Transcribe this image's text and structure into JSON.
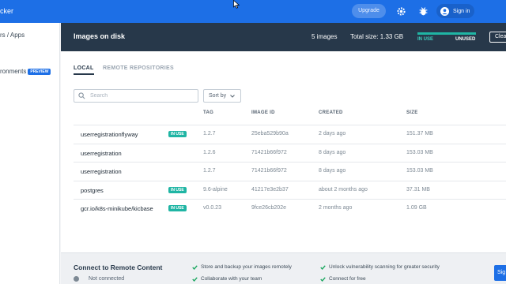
{
  "topbar": {
    "brand": "cker",
    "upgrade_label": "Upgrade",
    "signin_label": "Sign in"
  },
  "sidebar": {
    "items": [
      {
        "label": "rs / Apps"
      },
      {
        "label": "ronments",
        "badge": "PREVIEW"
      }
    ]
  },
  "header": {
    "title": "Images on disk",
    "count": "5 images",
    "total_size": "Total size: 1.33 GB",
    "usage_in_use_fraction": 1.0,
    "label_in_use": "IN USE",
    "label_unused": "UNUSED",
    "clean_label": "Clea"
  },
  "tabs": [
    {
      "label": "LOCAL",
      "active": true
    },
    {
      "label": "REMOTE REPOSITORIES",
      "active": false
    }
  ],
  "search": {
    "placeholder": "Search"
  },
  "sort": {
    "label": "Sort by"
  },
  "table": {
    "columns": [
      "TAG",
      "IMAGE ID",
      "CREATED",
      "SIZE"
    ],
    "rows": [
      {
        "name": "userregistrationflyway",
        "in_use": "IN USE",
        "tag": "1.2.7",
        "image_id": "25eba529b90a",
        "created": "2 days ago",
        "size": "151.37 MB"
      },
      {
        "name": "userregistration",
        "in_use": "",
        "tag": "1.2.6",
        "image_id": "71421b66f972",
        "created": "8 days ago",
        "size": "153.03 MB"
      },
      {
        "name": "userregistration",
        "in_use": "",
        "tag": "1.2.7",
        "image_id": "71421b66f972",
        "created": "8 days ago",
        "size": "153.03 MB"
      },
      {
        "name": "postgres",
        "in_use": "IN USE",
        "tag": "9.6-alpine",
        "image_id": "41217e3e2b37",
        "created": "about 2 months ago",
        "size": "37.31 MB"
      },
      {
        "name": "gcr.io/k8s-minikube/kicbase",
        "in_use": "IN USE",
        "tag": "v0.0.23",
        "image_id": "9fce26cb202e",
        "created": "2 months ago",
        "size": "1.09 GB"
      }
    ]
  },
  "footer": {
    "title": "Connect to Remote Content",
    "status": "Not connected",
    "features": [
      "Store and backup your images remotely",
      "Collaborate with your team",
      "Unlock vulnerability scanning for greater security",
      "Connect for free"
    ],
    "signin_label": "Sig"
  },
  "colors": {
    "topbar": "#1d6fe6",
    "header": "#27384a",
    "in_use_badge": "#1fb5a4"
  }
}
